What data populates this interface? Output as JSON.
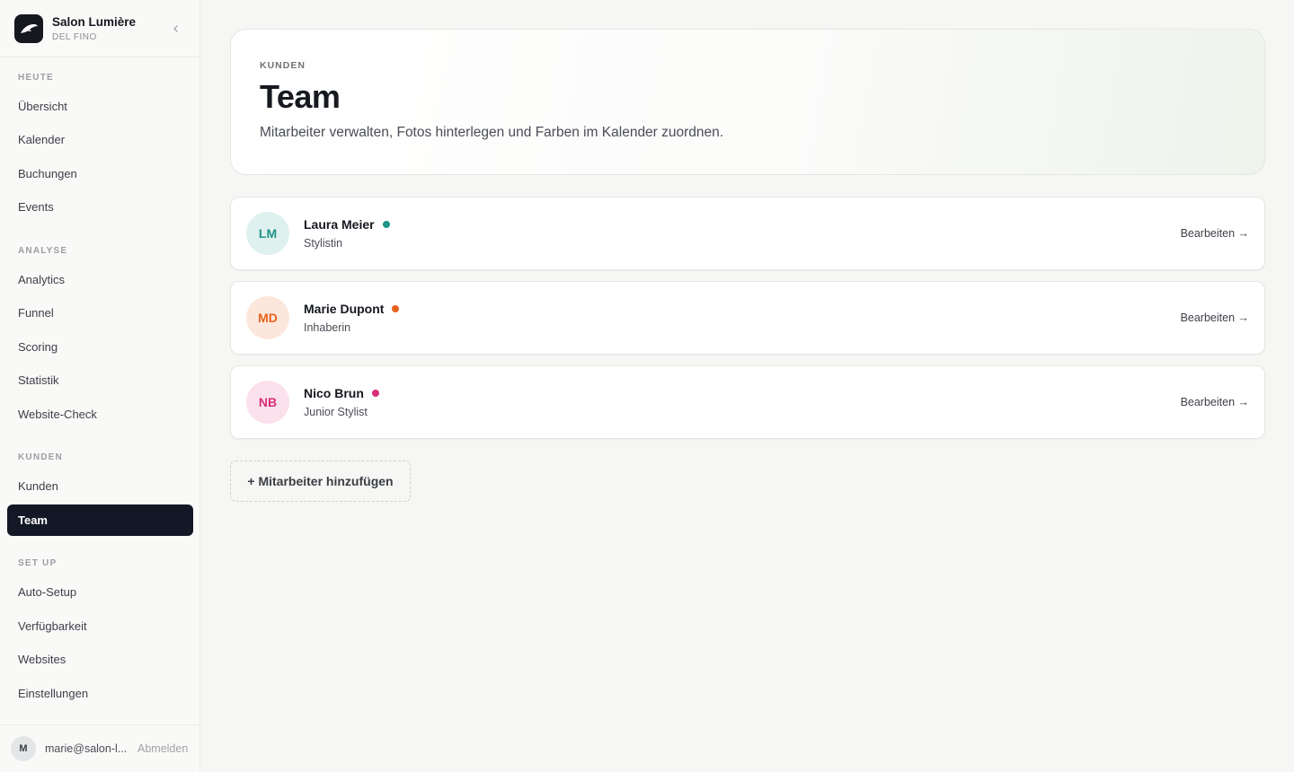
{
  "brand": {
    "name": "Salon Lumière",
    "sub": "DEL FINO"
  },
  "sidebar": {
    "sections": [
      {
        "label": "HEUTE",
        "items": [
          "Übersicht",
          "Kalender",
          "Buchungen",
          "Events"
        ]
      },
      {
        "label": "ANALYSE",
        "items": [
          "Analytics",
          "Funnel",
          "Scoring",
          "Statistik",
          "Website-Check"
        ]
      },
      {
        "label": "KUNDEN",
        "items": [
          "Kunden",
          "Team"
        ]
      },
      {
        "label": "SET UP",
        "items": [
          "Auto-Setup",
          "Verfügbarkeit",
          "Websites",
          "Einstellungen"
        ]
      }
    ],
    "active": "Team"
  },
  "user": {
    "initial": "M",
    "email": "marie@salon-l...",
    "logout": "Abmelden"
  },
  "header": {
    "eyebrow": "KUNDEN",
    "title": "Team",
    "description": "Mitarbeiter verwalten, Fotos hinterlegen und Farben im Kalender zuordnen."
  },
  "members": [
    {
      "initials": "LM",
      "name": "Laura Meier",
      "role": "Stylistin",
      "color": "#1f9488",
      "avatar_bg": "#dff1ee",
      "edit": "Bearbeiten →"
    },
    {
      "initials": "MD",
      "name": "Marie Dupont",
      "role": "Inhaberin",
      "color": "#e8611c",
      "avatar_bg": "#fce7dc",
      "edit": "Bearbeiten →"
    },
    {
      "initials": "NB",
      "name": "Nico Brun",
      "role": "Junior Stylist",
      "color": "#d62f78",
      "avatar_bg": "#fbe1ec",
      "edit": "Bearbeiten →"
    }
  ],
  "add_button": "+ Mitarbeiter hinzufügen"
}
